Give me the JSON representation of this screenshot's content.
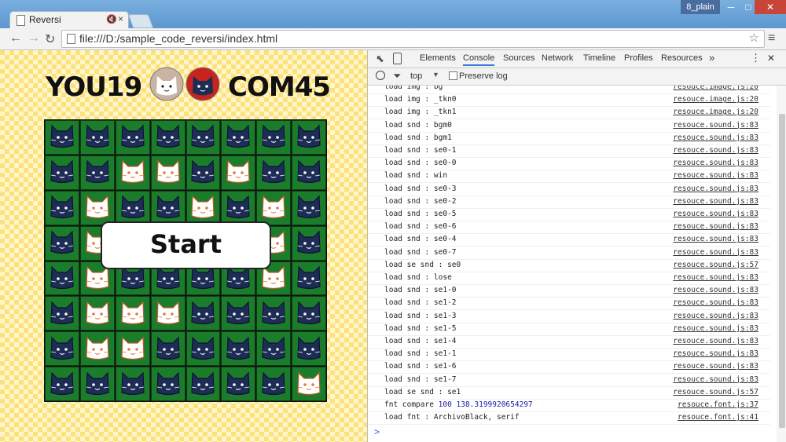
{
  "window": {
    "tab_title": "Reversi",
    "tab_mute": "🔇",
    "tab_close": "×",
    "profile": "8_plain",
    "minimize": "─",
    "maximize": "□",
    "close": "✕"
  },
  "toolbar": {
    "back": "←",
    "forward": "→",
    "reload": "↻",
    "url": "file:///D:/sample_code_reversi/index.html",
    "star": "☆",
    "menu": "≡"
  },
  "game": {
    "player_score": "YOU19",
    "com_score": "COM45",
    "start_label": "Start",
    "board": [
      "BBBBBBBB",
      "BBWWBWBB",
      "BWBBWBWB",
      "BWBBBBWB",
      "BWBBBBWB",
      "BWWWBBBB",
      "BWWBBBBB",
      "BBBBBBBW"
    ]
  },
  "devtools": {
    "tabs": [
      "Elements",
      "Console",
      "Sources",
      "Network",
      "Timeline",
      "Profiles",
      "Resources"
    ],
    "active_tab": "Console",
    "more": "»",
    "kebab": "⋮",
    "close": "✕",
    "context": "top",
    "preserve_log": "Preserve log",
    "prompt": ">",
    "logs": [
      {
        "msg": "load img : bg",
        "src": "resouce.image.js:20"
      },
      {
        "msg": "load img : _tkn0",
        "src": "resouce.image.js:20"
      },
      {
        "msg": "load img : _tkn1",
        "src": "resouce.image.js:20"
      },
      {
        "msg": "load snd : bgm0",
        "src": "resouce.sound.js:83"
      },
      {
        "msg": "load snd : bgm1",
        "src": "resouce.sound.js:83"
      },
      {
        "msg": "load snd : se0-1",
        "src": "resouce.sound.js:83"
      },
      {
        "msg": "load snd : se0-0",
        "src": "resouce.sound.js:83"
      },
      {
        "msg": "load snd : win",
        "src": "resouce.sound.js:83"
      },
      {
        "msg": "load snd : se0-3",
        "src": "resouce.sound.js:83"
      },
      {
        "msg": "load snd : se0-2",
        "src": "resouce.sound.js:83"
      },
      {
        "msg": "load snd : se0-5",
        "src": "resouce.sound.js:83"
      },
      {
        "msg": "load snd : se0-6",
        "src": "resouce.sound.js:83"
      },
      {
        "msg": "load snd : se0-4",
        "src": "resouce.sound.js:83"
      },
      {
        "msg": "load snd : se0-7",
        "src": "resouce.sound.js:83"
      },
      {
        "msg": "load se snd : se0",
        "src": "resouce.sound.js:57"
      },
      {
        "msg": "load snd : lose",
        "src": "resouce.sound.js:83"
      },
      {
        "msg": "load snd : se1-0",
        "src": "resouce.sound.js:83"
      },
      {
        "msg": "load snd : se1-2",
        "src": "resouce.sound.js:83"
      },
      {
        "msg": "load snd : se1-3",
        "src": "resouce.sound.js:83"
      },
      {
        "msg": "load snd : se1-5",
        "src": "resouce.sound.js:83"
      },
      {
        "msg": "load snd : se1-4",
        "src": "resouce.sound.js:83"
      },
      {
        "msg": "load snd : se1-1",
        "src": "resouce.sound.js:83"
      },
      {
        "msg": "load snd : se1-6",
        "src": "resouce.sound.js:83"
      },
      {
        "msg": "load snd : se1-7",
        "src": "resouce.sound.js:83"
      },
      {
        "msg": "load se snd : se1",
        "src": "resouce.sound.js:57"
      },
      {
        "msg": "fnt compare ",
        "num": "100 138.3199920654297",
        "src": "resouce.font.js:37"
      },
      {
        "msg": "load fnt : ArchivoBlack, serif",
        "src": "resouce.font.js:41"
      }
    ]
  },
  "colors": {
    "board_green": "#1b7d2c",
    "black_cat": "#1e2d55",
    "white_cat": "#ffffff",
    "cat_accent": "#e07a3f",
    "link_blue": "#3879d9"
  }
}
